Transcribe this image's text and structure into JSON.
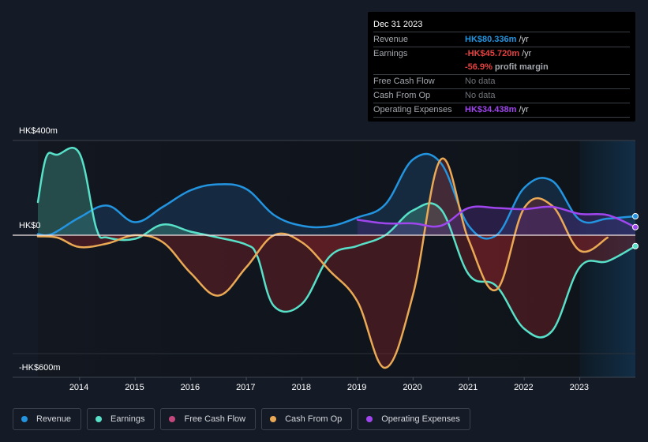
{
  "tooltip": {
    "date": "Dec 31 2023",
    "rows": [
      {
        "label": "Revenue",
        "value": "HK$80.336m",
        "unit": "/yr",
        "color": "#2394df"
      },
      {
        "label": "Earnings",
        "value": "-HK$45.720m",
        "unit": "/yr",
        "color": "#e64141"
      },
      {
        "label": "",
        "value": "-56.9%",
        "unit": "profit margin",
        "color": "#e64141"
      },
      {
        "label": "Free Cash Flow",
        "value": "No data",
        "unit": "",
        "color": ""
      },
      {
        "label": "Cash From Op",
        "value": "No data",
        "unit": "",
        "color": ""
      },
      {
        "label": "Operating Expenses",
        "value": "HK$34.438m",
        "unit": "/yr",
        "color": "#a046ee"
      }
    ]
  },
  "legend": [
    {
      "label": "Revenue",
      "color": "#2394df"
    },
    {
      "label": "Earnings",
      "color": "#58e1c9"
    },
    {
      "label": "Free Cash Flow",
      "color": "#c4487e"
    },
    {
      "label": "Cash From Op",
      "color": "#eaa954"
    },
    {
      "label": "Operating Expenses",
      "color": "#a046ee"
    }
  ],
  "chart_data": {
    "type": "area",
    "title": "",
    "xlabel": "",
    "ylabel": "",
    "currency_unit": "HK$ millions",
    "y_tick_labels": [
      "HK$400m",
      "HK$0",
      "-HK$600m"
    ],
    "y_ticks": [
      400,
      0,
      -500
    ],
    "ylim": [
      -600,
      400
    ],
    "xlim": [
      2013.25,
      2024.0
    ],
    "x_tick_labels": [
      "2014",
      "2015",
      "2016",
      "2017",
      "2018",
      "2019",
      "2020",
      "2021",
      "2022",
      "2023"
    ],
    "x_ticks": [
      2014,
      2015,
      2016,
      2017,
      2018,
      2019,
      2020,
      2021,
      2022,
      2023
    ],
    "forecast_shade_from": 2023.0,
    "legend_position": "bottom",
    "grid": true,
    "series": [
      {
        "name": "Revenue",
        "color": "#2394df",
        "x": [
          2013.25,
          2013.5,
          2014.0,
          2014.5,
          2015.0,
          2015.5,
          2016.0,
          2016.5,
          2017.0,
          2017.5,
          2018.0,
          2018.5,
          2019.0,
          2019.5,
          2020.0,
          2020.5,
          2021.0,
          2021.5,
          2022.0,
          2022.5,
          2023.0,
          2023.5,
          2024.0
        ],
        "values": [
          5,
          5,
          75,
          125,
          55,
          120,
          190,
          215,
          195,
          85,
          40,
          38,
          75,
          130,
          320,
          305,
          40,
          0,
          200,
          230,
          65,
          70,
          80
        ]
      },
      {
        "name": "Earnings",
        "color": "#58e1c9",
        "x": [
          2013.25,
          2013.4,
          2013.6,
          2014.0,
          2014.3,
          2014.5,
          2015.0,
          2015.5,
          2016.0,
          2016.5,
          2017.0,
          2017.2,
          2017.5,
          2018.0,
          2018.5,
          2019.0,
          2019.5,
          2020.0,
          2020.5,
          2021.0,
          2021.5,
          2022.0,
          2022.5,
          2023.0,
          2023.5,
          2024.0
        ],
        "values": [
          140,
          330,
          340,
          345,
          30,
          -10,
          -15,
          45,
          15,
          -10,
          -40,
          -90,
          -300,
          -290,
          -90,
          -45,
          0,
          105,
          110,
          -165,
          -215,
          -395,
          -405,
          -135,
          -110,
          -46
        ]
      },
      {
        "name": "Cash From Op",
        "color": "#eaa954",
        "x": [
          2013.25,
          2013.6,
          2014.0,
          2014.5,
          2015.0,
          2015.5,
          2016.0,
          2016.5,
          2017.0,
          2017.5,
          2018.0,
          2018.5,
          2019.0,
          2019.5,
          2020.0,
          2020.5,
          2021.0,
          2021.5,
          2022.0,
          2022.5,
          2023.0,
          2023.5
        ],
        "values": [
          -5,
          -10,
          -50,
          -35,
          0,
          -30,
          -160,
          -255,
          -135,
          0,
          -30,
          -150,
          -280,
          -560,
          -250,
          320,
          -20,
          -230,
          115,
          125,
          -65,
          -10
        ]
      },
      {
        "name": "Operating Expenses",
        "color": "#a046ee",
        "x": [
          2019.0,
          2019.5,
          2020.0,
          2020.5,
          2021.0,
          2021.5,
          2022.0,
          2022.5,
          2023.0,
          2023.5,
          2024.0
        ],
        "values": [
          65,
          50,
          50,
          40,
          115,
          115,
          110,
          120,
          90,
          85,
          34
        ]
      }
    ]
  }
}
